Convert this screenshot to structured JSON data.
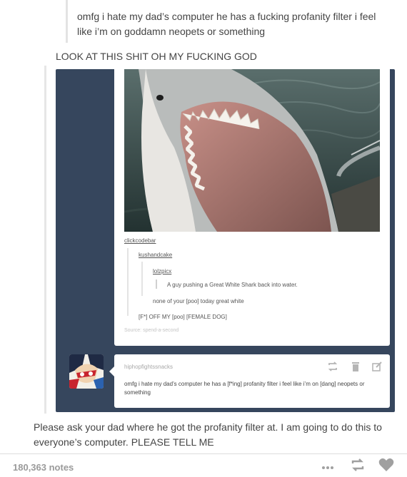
{
  "top_quote": {
    "text": "omfg i hate my dad’s computer he has a fucking profanity filter i feel like i’m on goddamn neopets or something"
  },
  "comment_1": "LOOK AT THIS SHIT OH MY FUCKING GOD",
  "post": {
    "image_icon": "great-white-shark-photo",
    "thread": {
      "level_1_user": "clickcodebar",
      "level_2_user": "kushandcake",
      "level_3_user": "lolzpicx",
      "caption": "A guy pushing a Great White Shark back into water.",
      "line_2": "none of your [poo] today great white",
      "line_3": "[F*] OFF MY [poo] [FEMALE DOG]",
      "source_label": "Source: spend-a-second"
    }
  },
  "reply": {
    "username": "hiphopfightssnacks",
    "text": "omfg i hate my dad’s computer he has a [f*ing] profanity filter i feel like i’m on [dang] neopets or something",
    "icons": [
      "reblog-icon",
      "trash-icon",
      "edit-icon"
    ]
  },
  "comment_2": "Please ask your dad where he got the profanity filter at. I am going to do this to everyone’s computer. PLEASE TELL ME",
  "footer": {
    "notes": "180,363 notes",
    "icons": [
      "more-dots-icon",
      "reblog-icon",
      "heart-icon"
    ]
  },
  "colors": {
    "dashboard_blue": "#36465d",
    "text": "#444444",
    "muted": "#9a9a9a"
  }
}
